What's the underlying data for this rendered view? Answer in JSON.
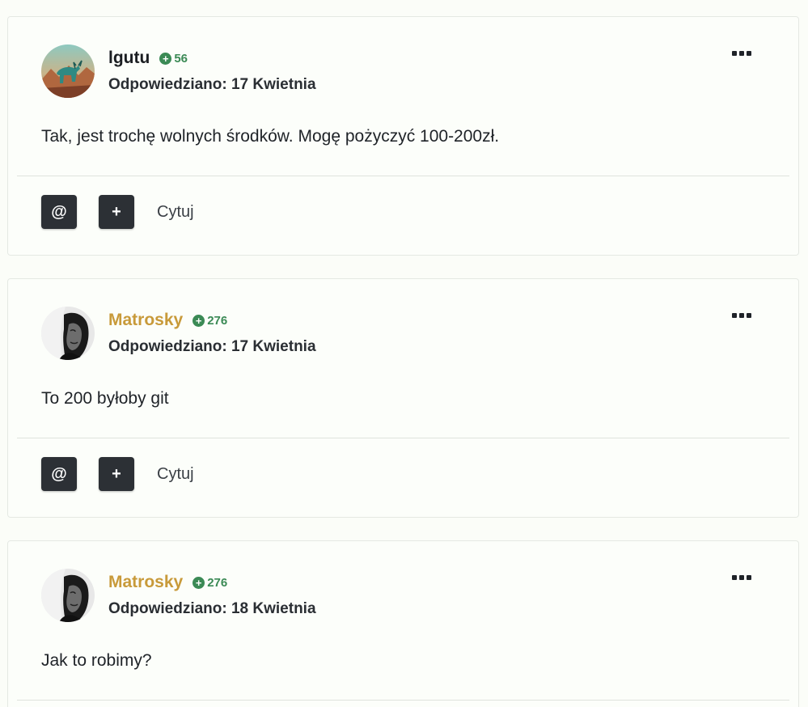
{
  "posts": [
    {
      "author": "lgutu",
      "reputation": "56",
      "meta": "Odpowiedziano: 17 Kwietnia",
      "content": "Tak, jest trochę wolnych środków. Mogę pożyczyć 100-200zł.",
      "mention_icon": "@",
      "plus_icon": "+",
      "quote_label": "Cytuj"
    },
    {
      "author": "Matrosky",
      "reputation": "276",
      "meta": "Odpowiedziano: 17 Kwietnia",
      "content": "To 200 byłoby git",
      "mention_icon": "@",
      "plus_icon": "+",
      "quote_label": "Cytuj"
    },
    {
      "author": "Matrosky",
      "reputation": "276",
      "meta": "Odpowiedziano: 18 Kwietnia",
      "content": "Jak to robimy?"
    }
  ],
  "colors": {
    "author_gold": "#c89a3a",
    "reputation_green": "#3b8a55",
    "button_dark": "#2c3035"
  },
  "icons": {
    "reputation": "plus-circle-icon",
    "menu": "ellipsis-icon",
    "mention": "at-icon",
    "plus": "plus-icon"
  }
}
